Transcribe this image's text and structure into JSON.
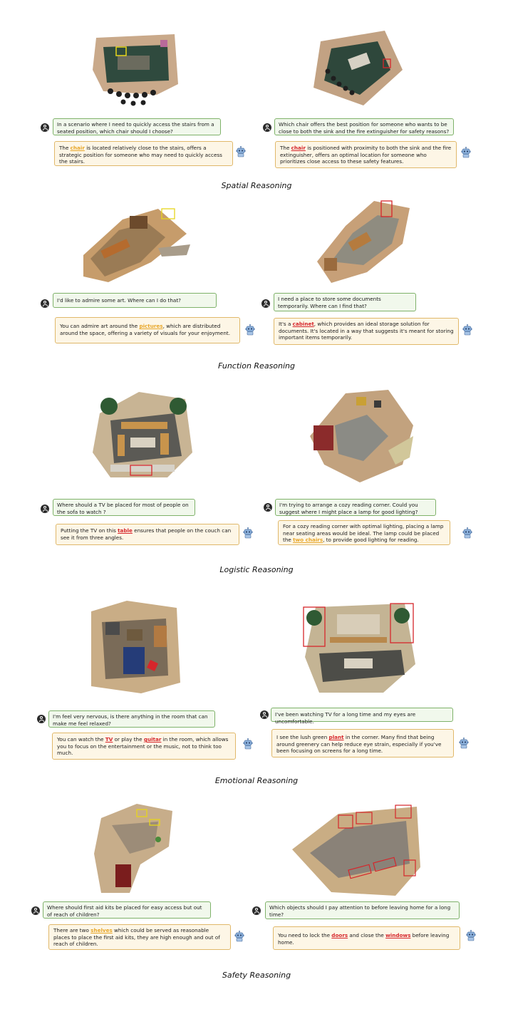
{
  "sections": [
    {
      "caption": "Spatial Reasoning",
      "left": {
        "question": "In a scenario where I need to quickly access the stairs from a seated position, which chair should I choose?",
        "answer_pre": "The ",
        "answer_kw": "chair",
        "answer_post": " is located relatively close to the stairs, offers a strategic position for someone who may need to quickly access the stairs."
      },
      "right": {
        "question": "Which chair offers the best position for someone who wants to be close to both the sink and the fire extinguisher for safety reasons?",
        "answer_pre": "The ",
        "answer_kw": "chair",
        "answer_post": " is positioned with proximity to both the sink and the fire extinguisher, offers an optimal location for someone who prioritizes close access to these safety features."
      }
    },
    {
      "caption": "Function Reasoning",
      "left": {
        "question": "I'd like to admire some art. Where can I do that?",
        "answer_pre": "You can admire art around the ",
        "answer_kw": "pictures",
        "answer_post": ", which are distributed around the space, offering a variety of visuals for your enjoyment."
      },
      "right": {
        "question": "I need a place to store some documents temporarily. Where can I find that?",
        "answer_pre": "It's a ",
        "answer_kw": "cabinet",
        "answer_post": ", which provides an ideal storage solution for documents. It's located in a way that suggests it's meant for storing important items temporarily."
      }
    },
    {
      "caption": "Logistic Reasoning",
      "left": {
        "question": "Where should a TV be placed for most of people on the sofa to watch ?",
        "answer_pre": "Putting the TV on this ",
        "answer_kw": "table",
        "answer_post": " ensures that people on the couch can see it from three angles."
      },
      "right": {
        "question": "I'm trying to arrange a cozy reading corner. Could you suggest where I might place a lamp for good lighting?",
        "answer_pre": "For a cozy reading corner with optimal lighting, placing a lamp near seating areas would be ideal.  The lamp could be placed the ",
        "answer_kw": "two chairs",
        "answer_post": ", to provide good lighting for reading."
      }
    },
    {
      "caption": "Emotional Reasoning",
      "left": {
        "question": "I'm feel very nervous, is there anything in the room that can make me feel relaxed?",
        "answer_pre": "You can watch the ",
        "answer_kw": "TV",
        "answer_mid": " or play the ",
        "answer_kw2": "guitar",
        "answer_post": " in the room, which allows you to focus on the entertainment or the music, not to think too much."
      },
      "right": {
        "question": "I've been watching TV for a long time and my eyes are uncomfortable.",
        "answer_pre": "I see the lush green ",
        "answer_kw": "plant",
        "answer_post": " in the corner. Many find that being around greenery can help reduce eye strain, especially if you've been focusing on screens for a long time."
      }
    },
    {
      "caption": "Safety Reasoning",
      "left": {
        "question": "Where should first aid kits be placed for easy access but out of reach of children?",
        "answer_pre": "There are two ",
        "answer_kw": "shelves",
        "answer_post": " which could be served as reasonable places to place the first aid kits, they are high enough  and out of reach of children."
      },
      "right": {
        "question": "Which objects should I pay attention to before leaving home for a long time?",
        "answer_pre": "You need to lock the ",
        "answer_kw": "doors",
        "answer_mid": " and close the ",
        "answer_kw2": "windows",
        "answer_post": " before leaving home."
      }
    }
  ],
  "colors": {
    "question_bg": "#f1f8ec",
    "question_border": "#7fb26a",
    "answer_bg": "#fdf6e6",
    "answer_border": "#e0b86a",
    "keyword_yellow": "#e8a72a",
    "keyword_red": "#d6262b"
  },
  "icons": {
    "user": "user-avatar-icon",
    "assistant": "robot-icon"
  }
}
